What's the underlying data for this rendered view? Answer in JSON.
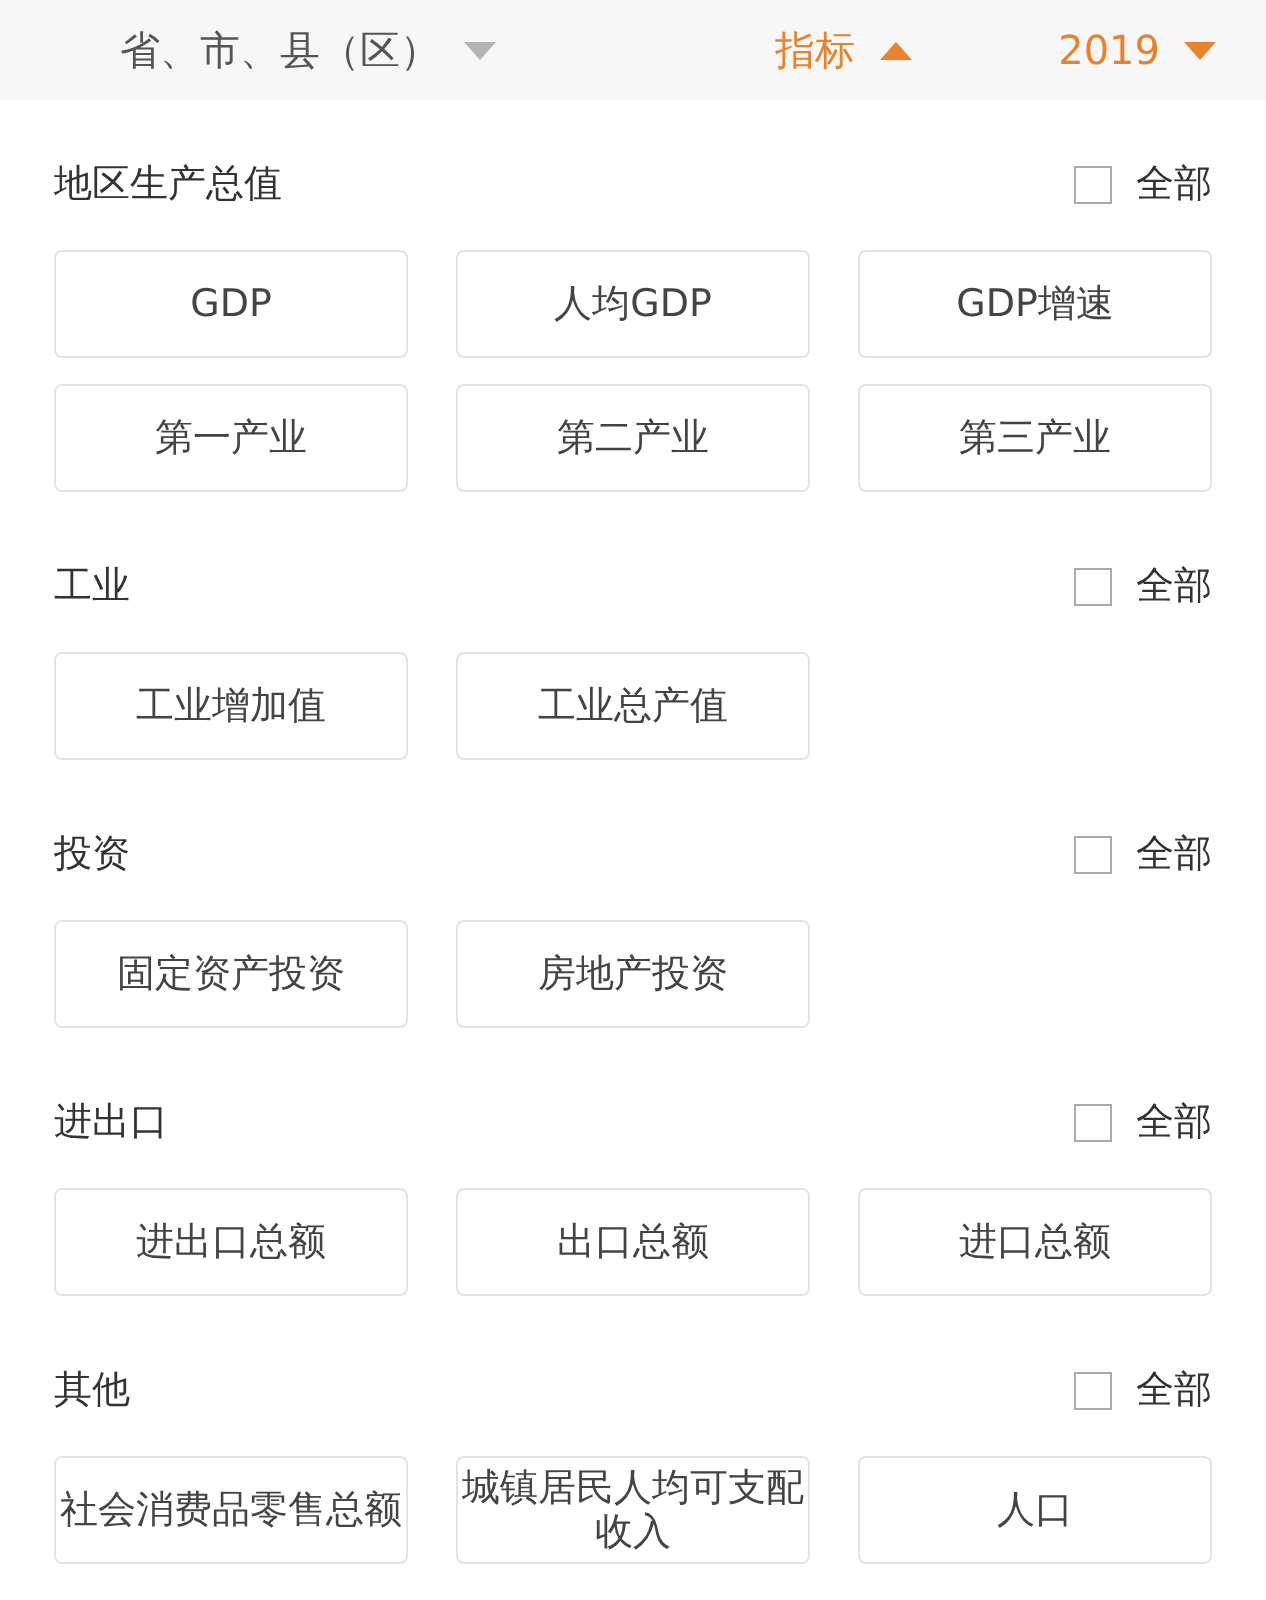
{
  "filter_tabs": [
    {
      "label": "省、市、县（区）",
      "selected": false,
      "expanded": false
    },
    {
      "label": "指标",
      "selected": true,
      "expanded": true
    },
    {
      "label": "2019",
      "selected": true,
      "expanded": false
    }
  ],
  "sections": [
    {
      "title": "地区生产总值",
      "select_all": {
        "label": "全部",
        "checked": false
      },
      "options": [
        "GDP",
        "人均GDP",
        "GDP增速",
        "第一产业",
        "第二产业",
        "第三产业"
      ]
    },
    {
      "title": "工业",
      "select_all": {
        "label": "全部",
        "checked": false
      },
      "options": [
        "工业增加值",
        "工业总产值"
      ]
    },
    {
      "title": "投资",
      "select_all": {
        "label": "全部",
        "checked": false
      },
      "options": [
        "固定资产投资",
        "房地产投资"
      ]
    },
    {
      "title": "进出口",
      "select_all": {
        "label": "全部",
        "checked": false
      },
      "options": [
        "进出口总额",
        "出口总额",
        "进口总额"
      ]
    },
    {
      "title": "其他",
      "select_all": {
        "label": "全部",
        "checked": false
      },
      "options": [
        "社会消费品零售总额",
        "城镇居民人均可支配收入",
        "人口"
      ]
    }
  ]
}
